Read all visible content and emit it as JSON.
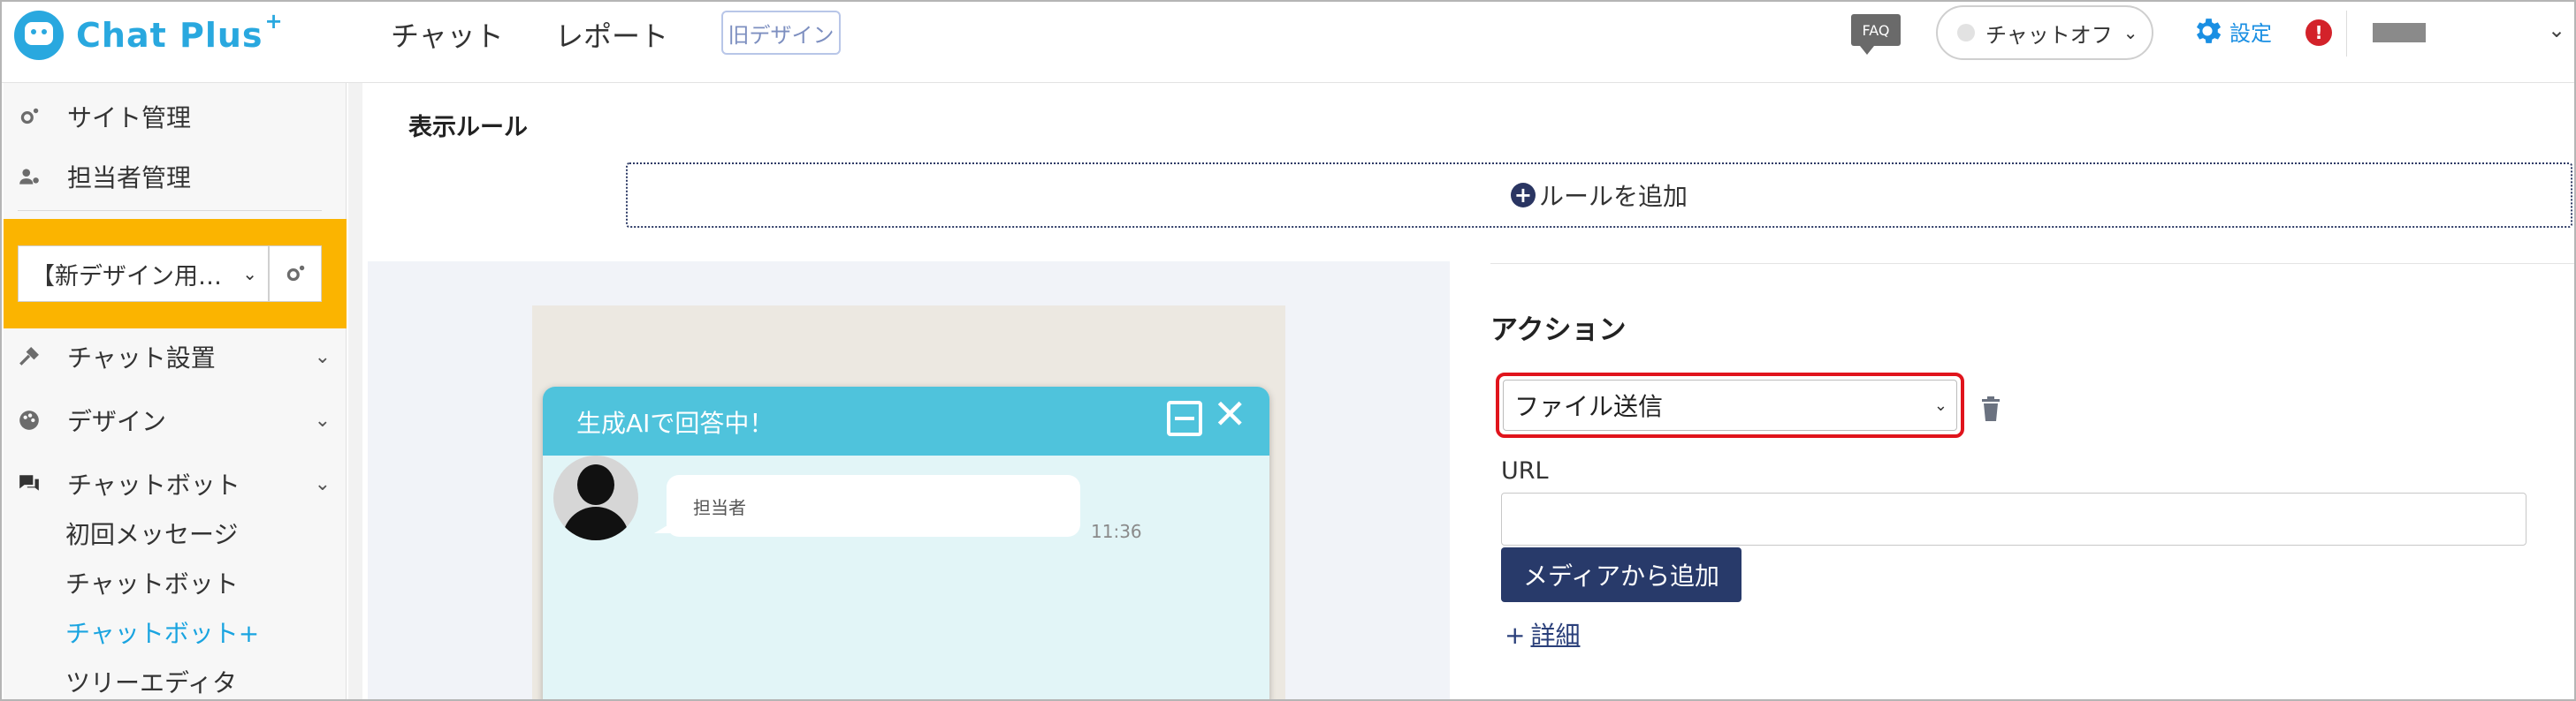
{
  "header": {
    "logo_text": "Chat Plus",
    "logo_sup": "+",
    "nav": [
      "チャット",
      "レポート"
    ],
    "old_design": "旧デザイン",
    "faq": "FAQ",
    "chat_status": "チャットオフ",
    "settings": "設定",
    "alert": "!"
  },
  "sidebar": {
    "site_admin": "サイト管理",
    "staff_admin": "担当者管理",
    "site_select": "【新デザイン用…",
    "chat_setup": "チャット設置",
    "design": "デザイン",
    "chatbot": "チャットボット",
    "sub_items": [
      "初回メッセージ",
      "チャットボット",
      "チャットボット+",
      "ツリーエディタ"
    ]
  },
  "main": {
    "display_rule_title": "表示ルール",
    "add_rule": "ルールを追加",
    "preview": {
      "title": "生成AIで回答中！",
      "agent_label": "担当者",
      "time": "11:36"
    },
    "action": {
      "title": "アクション",
      "selected": "ファイル送信",
      "url_label": "URL",
      "url_value": "",
      "media_button": "メディアから追加",
      "detail_link": "詳細"
    }
  },
  "colors": {
    "brand": "#29a8df",
    "highlight_site": "#fbb400",
    "chat_header": "#4fc3dc",
    "primary_button": "#283a6a",
    "alert": "#d3222a",
    "focus_outline": "#e0141c"
  }
}
